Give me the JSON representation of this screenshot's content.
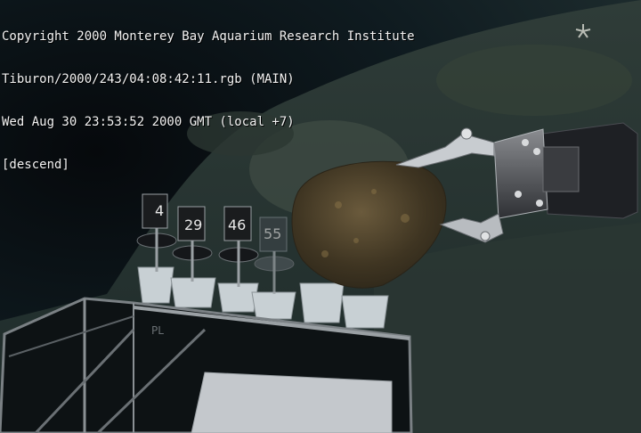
{
  "overlay": {
    "copyright": "Copyright 2000 Monterey Bay Aquarium Research Institute",
    "source": "Tiburon/2000/243/04:08:42:11.rgb (MAIN)",
    "timestamp": "Wed Aug 30 23:53:52 2000 GMT (local +7)",
    "mode": "[descend]"
  },
  "tubes": [
    {
      "label": "4"
    },
    {
      "label": "29"
    },
    {
      "label": "46"
    },
    {
      "label": "55"
    }
  ]
}
